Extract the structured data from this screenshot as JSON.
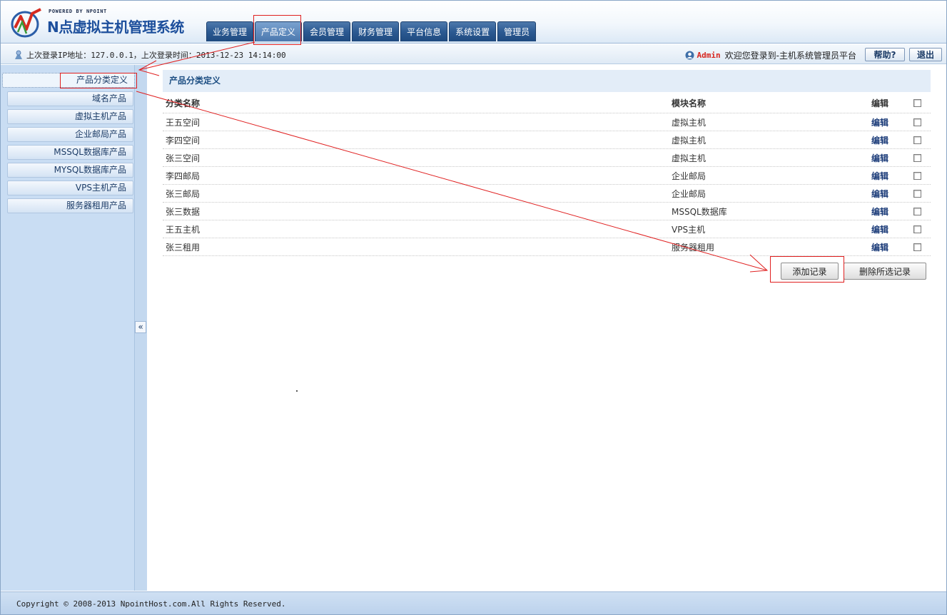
{
  "logo": {
    "powered": "POWERED BY NPOINT",
    "title": "N点虚拟主机管理系统"
  },
  "nav": {
    "tabs": [
      {
        "label": "业务管理",
        "active": false
      },
      {
        "label": "产品定义",
        "active": true
      },
      {
        "label": "会员管理",
        "active": false
      },
      {
        "label": "财务管理",
        "active": false
      },
      {
        "label": "平台信息",
        "active": false
      },
      {
        "label": "系统设置",
        "active": false
      },
      {
        "label": "管理员",
        "active": false
      }
    ]
  },
  "infobar": {
    "login_info": "上次登录IP地址：127.0.0.1，上次登录时间：2013-12-23 14:14:00",
    "user_name": "Admin",
    "welcome": "欢迎您登录到-主机系统管理员平台",
    "help_label": "帮助?",
    "logout_label": "退出"
  },
  "sidebar": {
    "items": [
      {
        "label": "产品分类定义",
        "active": true
      },
      {
        "label": "域名产品",
        "active": false
      },
      {
        "label": "虚拟主机产品",
        "active": false
      },
      {
        "label": "企业邮局产品",
        "active": false
      },
      {
        "label": "MSSQL数据库产品",
        "active": false
      },
      {
        "label": "MYSQL数据库产品",
        "active": false
      },
      {
        "label": "VPS主机产品",
        "active": false
      },
      {
        "label": "服务器租用产品",
        "active": false
      }
    ],
    "collapse_label": "«"
  },
  "main": {
    "title": "产品分类定义",
    "columns": {
      "name": "分类名称",
      "module": "模块名称",
      "edit": "编辑"
    },
    "rows": [
      {
        "name": "王五空间",
        "module": "虚拟主机",
        "edit": "编辑",
        "checked": false
      },
      {
        "name": "李四空间",
        "module": "虚拟主机",
        "edit": "编辑",
        "checked": false
      },
      {
        "name": "张三空间",
        "module": "虚拟主机",
        "edit": "编辑",
        "checked": false
      },
      {
        "name": "李四邮局",
        "module": "企业邮局",
        "edit": "编辑",
        "checked": false
      },
      {
        "name": "张三邮局",
        "module": "企业邮局",
        "edit": "编辑",
        "checked": false
      },
      {
        "name": "张三数据",
        "module": "MSSQL数据库",
        "edit": "编辑",
        "checked": false
      },
      {
        "name": "王五主机",
        "module": "VPS主机",
        "edit": "编辑",
        "checked": false
      },
      {
        "name": "张三租用",
        "module": "服务器租用",
        "edit": "编辑",
        "checked": false
      }
    ],
    "add_label": "添加记录",
    "delete_label": "删除所选记录"
  },
  "footer": {
    "copyright": "Copyright © 2008-2013 NpointHost.com.All Rights Reserved."
  },
  "colors": {
    "nav_tab": "#2c5a92",
    "sidebar_bg": "#c9ddf3",
    "annotation": "#e02020",
    "admin_name": "#d7261f"
  },
  "icons": {
    "logo": "npoint-logo-icon",
    "login": "user-login-icon",
    "welcome_user": "user-avatar-icon",
    "collapse": "double-chevron-left-icon"
  }
}
